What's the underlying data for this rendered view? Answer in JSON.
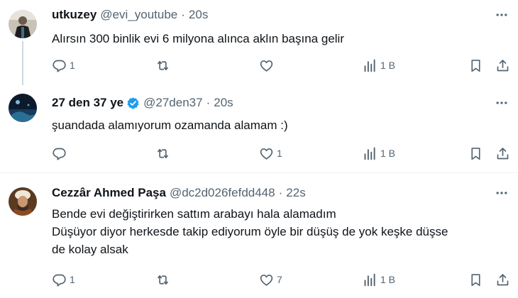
{
  "tweets": [
    {
      "name": "utkuzey",
      "handle": "@evi_youtube",
      "dot": "·",
      "time": "20s",
      "verified": false,
      "lines": [
        "Alırsın 300 binlik evi 6 milyona alınca aklın başına gelir"
      ],
      "replies": "1",
      "retweets": "",
      "likes": "",
      "views": "1 B"
    },
    {
      "name": "27 den 37 ye",
      "handle": "@27den37",
      "dot": "·",
      "time": "20s",
      "verified": true,
      "lines": [
        "şuandada alamıyorum ozamanda alamam :)"
      ],
      "replies": "",
      "retweets": "",
      "likes": "1",
      "views": "1 B"
    },
    {
      "name": "Cezzâr Ahmed Paşa",
      "handle": "@dc2d026fefdd448",
      "dot": "·",
      "time": "22s",
      "verified": false,
      "lines": [
        "Bende evi değiştirirken sattım arabayı hala alamadım",
        "Düşüyor diyor herkesde takip ediyorum öyle bir düşüş de yok keşke düşse",
        "de kolay alsak"
      ],
      "replies": "1",
      "retweets": "",
      "likes": "7",
      "views": "1 B"
    }
  ],
  "colors": {
    "text": "#0f1419",
    "secondary": "#536471",
    "verified": "#1d9bf0",
    "divider": "#eff3f4",
    "thread_line": "#cfd9de"
  },
  "icons": [
    "reply-icon",
    "retweet-icon",
    "like-icon",
    "views-icon",
    "bookmark-icon",
    "share-icon",
    "more-icon",
    "verified-badge-icon"
  ]
}
